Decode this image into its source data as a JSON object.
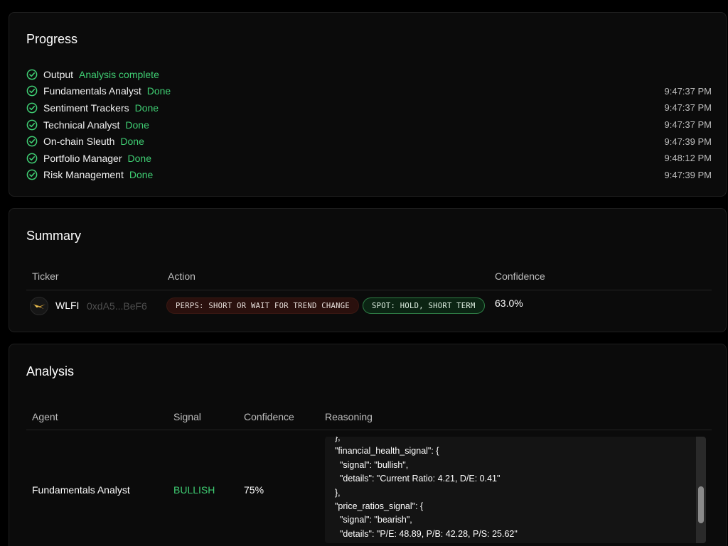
{
  "progress": {
    "title": "Progress",
    "items": [
      {
        "name": "Output",
        "status": "Analysis complete",
        "time": ""
      },
      {
        "name": "Fundamentals Analyst",
        "status": "Done",
        "time": "9:47:37 PM"
      },
      {
        "name": "Sentiment Trackers",
        "status": "Done",
        "time": "9:47:37 PM"
      },
      {
        "name": "Technical Analyst",
        "status": "Done",
        "time": "9:47:37 PM"
      },
      {
        "name": "On-chain Sleuth",
        "status": "Done",
        "time": "9:47:39 PM"
      },
      {
        "name": "Portfolio Manager",
        "status": "Done",
        "time": "9:48:12 PM"
      },
      {
        "name": "Risk Management",
        "status": "Done",
        "time": "9:47:39 PM"
      }
    ],
    "icon": "check-circle-icon",
    "status_color": "#3fce73"
  },
  "summary": {
    "title": "Summary",
    "headers": {
      "ticker": "Ticker",
      "action": "Action",
      "confidence": "Confidence"
    },
    "row": {
      "logo_icon": "wlfi-logo-icon",
      "symbol": "WLFI",
      "address": "0xdA5...BeF6",
      "perps_action": "PERPS: SHORT OR WAIT FOR TREND CHANGE",
      "spot_action": "SPOT: HOLD, SHORT TERM",
      "confidence": "63.0%"
    }
  },
  "analysis": {
    "title": "Analysis",
    "headers": {
      "agent": "Agent",
      "signal": "Signal",
      "confidence": "Confidence",
      "reasoning": "Reasoning"
    },
    "row": {
      "agent": "Fundamentals Analyst",
      "signal": "BULLISH",
      "confidence": "75%",
      "reasoning": "},\n\"financial_health_signal\": {\n  \"signal\": \"bullish\",\n  \"details\": \"Current Ratio: 4.21, D/E: 0.41\"\n},\n\"price_ratios_signal\": {\n  \"signal\": \"bearish\",\n  \"details\": \"P/E: 48.89, P/B: 42.28, P/S: 25.62\""
    }
  }
}
